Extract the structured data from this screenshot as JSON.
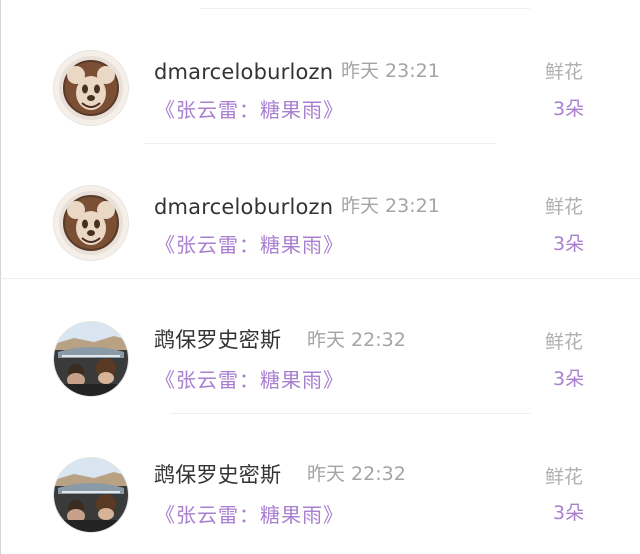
{
  "messages": [
    {
      "username": "dmarceloburlozn",
      "time": "昨天 23:21",
      "title": "《张云雷：糖果雨》",
      "gift_name": "鲜花",
      "gift_count": "3朵",
      "avatar_icon": "mickey-latte-art-avatar"
    },
    {
      "username": "dmarceloburlozn",
      "time": "昨天 23:21",
      "title": "《张云雷：糖果雨》",
      "gift_name": "鲜花",
      "gift_count": "3朵",
      "avatar_icon": "mickey-latte-art-avatar"
    },
    {
      "username": "鹉保罗史密斯",
      "time": "昨天 22:32",
      "title": "《张云雷：糖果雨》",
      "gift_name": "鲜花",
      "gift_count": "3朵",
      "avatar_icon": "convertible-car-photo-avatar"
    },
    {
      "username": "鹉保罗史密斯",
      "time": "昨天 22:32",
      "title": "《张云雷：糖果雨》",
      "gift_name": "鲜花",
      "gift_count": "3朵",
      "avatar_icon": "convertible-car-photo-avatar"
    }
  ],
  "colors": {
    "accent_purple": "#a97fd0",
    "username_text": "#333333",
    "meta_gray": "#a4a4a4",
    "gift_gray": "#b0b0b0"
  }
}
